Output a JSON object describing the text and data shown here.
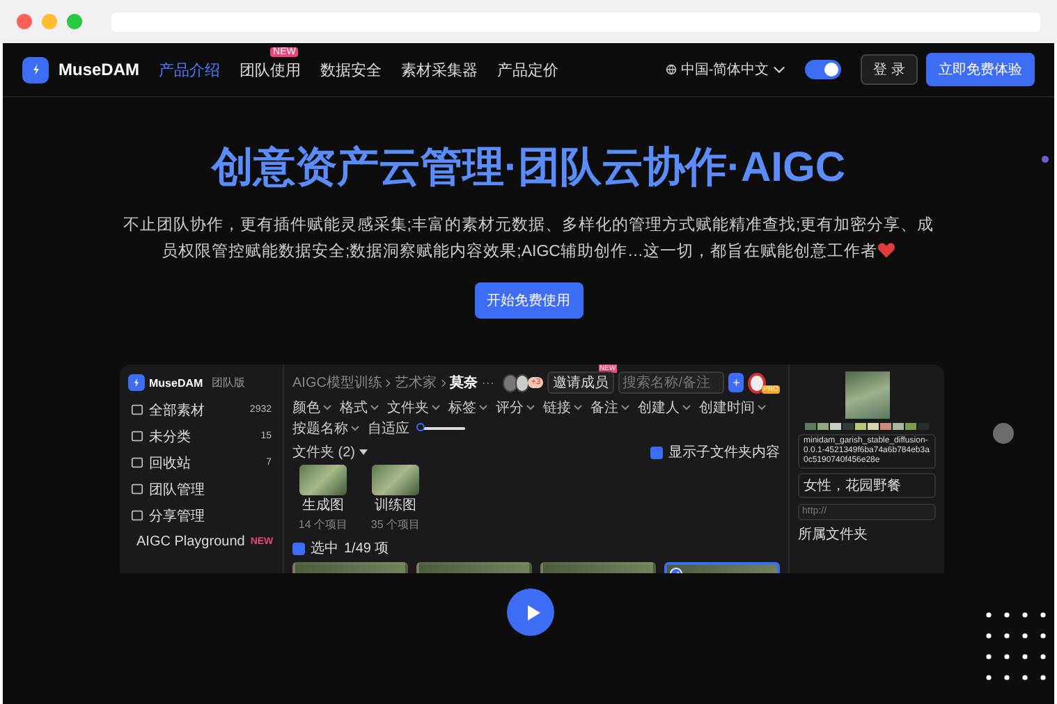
{
  "nav": {
    "logo": "MuseDAM",
    "items": [
      {
        "label": "产品介绍",
        "selected": true
      },
      {
        "label": "团队使用",
        "selected": false,
        "badge": "NEW"
      },
      {
        "label": "数据安全",
        "selected": false
      },
      {
        "label": "素材采集器",
        "selected": false
      },
      {
        "label": "产品定价",
        "selected": false
      }
    ],
    "language": "中国-简体中文",
    "theme_toggle": {
      "on": true
    },
    "login": "登 录",
    "cta": "立即免费体验"
  },
  "hero": {
    "title": "创意资产云管理·团队云协作·AIGC",
    "subtitle": "不止团队协作，更有插件赋能灵感采集;丰富的素材元数据、多样化的管理方式赋能精准查找;更有加密分享、成员权限管控赋能数据安全;数据洞察赋能内容效果;AIGC辅助创作…这一切，都旨在赋能创意工作者",
    "button": "开始免费使用"
  },
  "app": {
    "logo": "MuseDAM",
    "edition": "团队版",
    "sidebar": [
      {
        "label": "全部素材",
        "count": "2932",
        "selected": false
      },
      {
        "label": "未分类",
        "count": "15",
        "selected": false
      },
      {
        "label": "回收站",
        "count": "7",
        "selected": false
      },
      {
        "label": "团队管理",
        "selected": false
      },
      {
        "label": "分享管理",
        "selected": false
      },
      {
        "label": "AIGC Playground",
        "badge": "NEW",
        "selected": false
      }
    ],
    "breadcrumb": [
      "AIGC模型训练",
      "艺术家",
      "莫奈"
    ],
    "more": "···",
    "member_count": "+3",
    "invite": "邀请成员",
    "invite_badge": "NEW",
    "search": {
      "placeholder": "搜索名称/备注"
    },
    "plus": "+",
    "pro_badge": "PRO",
    "filters": [
      "颜色",
      "格式",
      "文件夹",
      "标签",
      "评分",
      "链接",
      "备注",
      "创建人",
      "创建时间",
      "按题名称"
    ],
    "fit": "自适应",
    "zoom": {
      "level": 0.05
    },
    "folders_label": "文件夹 (2)",
    "show_subfolders": {
      "label": "显示子文件夹内容",
      "checked": true
    },
    "folders": [
      {
        "name": "生成图",
        "count": "14 个项目"
      },
      {
        "name": "训练图",
        "count": "35 个项目"
      }
    ],
    "selection": {
      "label": "选中",
      "count": "1/49 项",
      "checked": true
    },
    "images": [
      {
        "selected": false
      },
      {
        "selected": false
      },
      {
        "selected": false
      },
      {
        "selected": true
      }
    ],
    "detail": {
      "palette": [
        {
          "color": "#5d7a5c"
        },
        {
          "color": "#8fa882"
        },
        {
          "color": "#c9cfc0"
        },
        {
          "color": "#2f4036"
        },
        {
          "color": "#b7c67a"
        },
        {
          "color": "#d9d3b0"
        },
        {
          "color": "#c98a7a"
        },
        {
          "color": "#a9b6a0"
        },
        {
          "color": "#7f9a4e"
        },
        {
          "color": "#223029"
        }
      ],
      "filename": "minidam_garish_stable_diffusion-0.0.1-4521349f6ba74a6b784eb3a0c5190740f456e28e",
      "description": "女性，花园野餐",
      "link": {
        "placeholder": "http://"
      },
      "section": "所属文件夹"
    }
  }
}
